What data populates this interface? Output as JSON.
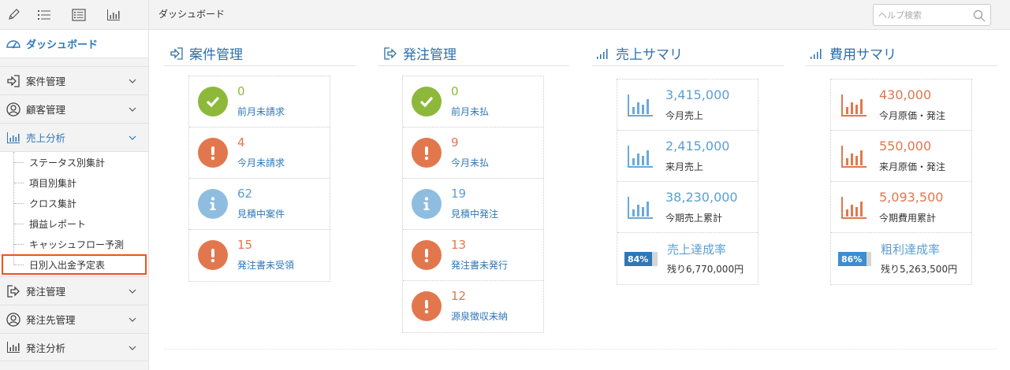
{
  "colors": {
    "accent": "#2e77b8",
    "ok": "#8db83a",
    "warn": "#e2774e",
    "info": "#8fbde0",
    "sales": "#69a9dc",
    "cost": "#e2774e",
    "selected_outline": "#e8561e"
  },
  "toolbar": {
    "icons": [
      "pencil-icon",
      "list-icon",
      "checklist-icon",
      "bar-chart-icon"
    ]
  },
  "sidebar": {
    "dashboard": "ダッシュボード",
    "groups": [
      {
        "label": "案件管理",
        "icon": "login-arrow-icon"
      },
      {
        "label": "顧客管理",
        "icon": "user-circle-icon"
      },
      {
        "label": "売上分析",
        "icon": "bar-chart-icon",
        "expanded": true
      },
      {
        "label": "発注管理",
        "icon": "logout-arrow-icon"
      },
      {
        "label": "発注先管理",
        "icon": "user-circle-icon"
      },
      {
        "label": "発注分析",
        "icon": "bar-chart-icon"
      }
    ],
    "sub_items": [
      "ステータス別集計",
      "項目別集計",
      "クロス集計",
      "損益レポート",
      "キャッシュフロー予測",
      "日別入出金予定表"
    ]
  },
  "header": {
    "breadcrumb": "ダッシュボード",
    "search_placeholder": "ヘルプ検索"
  },
  "sections": {
    "anken": {
      "title": "案件管理",
      "cards": [
        {
          "value": "0",
          "label": "前月未請求",
          "status": "ok"
        },
        {
          "value": "4",
          "label": "今月未請求",
          "status": "warn"
        },
        {
          "value": "62",
          "label": "見積中案件",
          "status": "info"
        },
        {
          "value": "15",
          "label": "発注書未受領",
          "status": "warn"
        }
      ]
    },
    "hatchu": {
      "title": "発注管理",
      "cards": [
        {
          "value": "0",
          "label": "前月未払",
          "status": "ok"
        },
        {
          "value": "9",
          "label": "今月未払",
          "status": "warn"
        },
        {
          "value": "19",
          "label": "見積中発注",
          "status": "info"
        },
        {
          "value": "13",
          "label": "発注書未発行",
          "status": "warn"
        },
        {
          "value": "12",
          "label": "源泉徴収未納",
          "status": "warn"
        }
      ]
    },
    "uriage": {
      "title": "売上サマリ",
      "cards": [
        {
          "value": "3,415,000",
          "label": "今月売上"
        },
        {
          "value": "2,415,000",
          "label": "来月売上"
        },
        {
          "value": "38,230,000",
          "label": "今期売上累計"
        }
      ],
      "rate": {
        "title": "売上達成率",
        "percent": 84,
        "percent_label": "84%",
        "remaining": "残り6,770,000円"
      }
    },
    "hiyou": {
      "title": "費用サマリ",
      "cards": [
        {
          "value": "430,000",
          "label": "今月原価・発注"
        },
        {
          "value": "550,000",
          "label": "来月原価・発注"
        },
        {
          "value": "5,093,500",
          "label": "今期費用累計"
        }
      ],
      "rate": {
        "title": "粗利達成率",
        "percent": 86,
        "percent_label": "86%",
        "remaining": "残り5,263,500円"
      }
    }
  }
}
